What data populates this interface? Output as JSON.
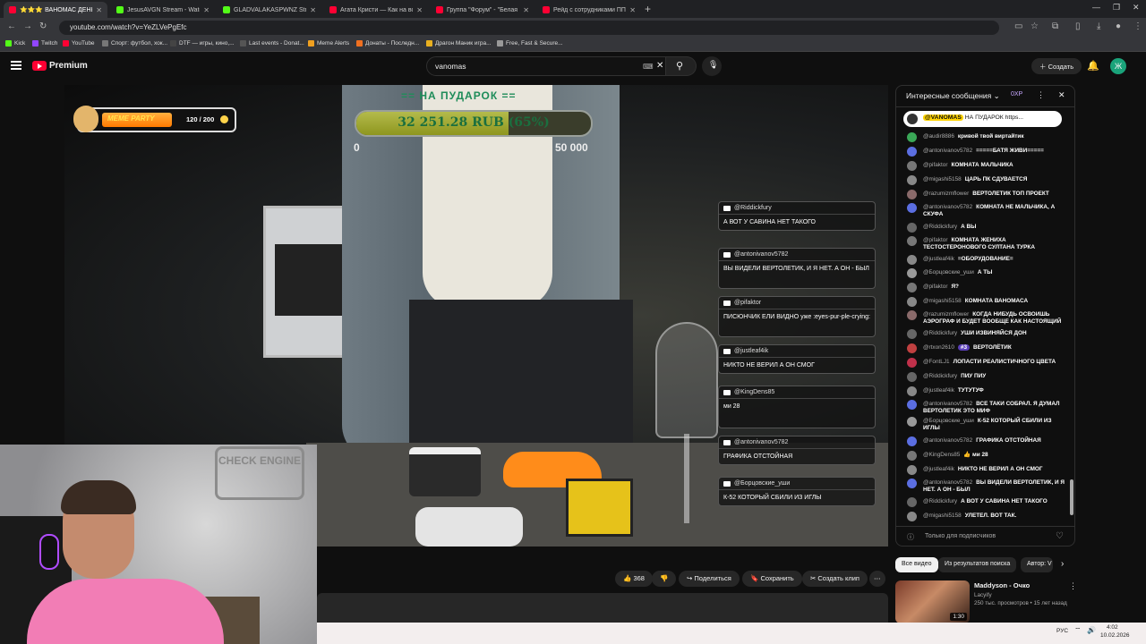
{
  "browser": {
    "tabs": [
      {
        "label": "⭐⭐⭐ ВАНОМАС ДЕНЬ РОЖ",
        "color": "#ff0033",
        "active": true
      },
      {
        "label": "JesusAVGN Stream - Watch Liv",
        "color": "#53fc18"
      },
      {
        "label": "GLADVALAKASPWNZ Stream -",
        "color": "#53fc18"
      },
      {
        "label": "Агата Кристи — Как на войне",
        "color": "#ff0033"
      },
      {
        "label": "Группа \"Форум\" - \"Белая ночь",
        "color": "#ff0033"
      },
      {
        "label": "Рейд с сотрудниками ППСП У",
        "color": "#ff0033"
      }
    ],
    "url": "youtube.com/watch?v=YeZLVePgEfc",
    "bookmarks": [
      "Kick",
      "Twitch",
      "YouTube",
      "Спорт: футбол, хок...",
      "DTF — игры, кино,...",
      "Last events - Donat...",
      "Meme Alerts",
      "Донаты - Последн...",
      "Драгон Маник игра...",
      "Free, Fast & Secure..."
    ]
  },
  "youtube": {
    "logo_text": "Premium",
    "search_value": "vanomas",
    "create_label": "Создать",
    "avatar_letter": "Ж"
  },
  "stream": {
    "meme_title": "MEME PARTY",
    "meme_count": "120 / 200",
    "goal_title": "== НА ПУДАРОК ==",
    "goal_amount": "32 251.28 RUB (65%)",
    "goal_progress": 0.65,
    "goal_min": "0",
    "goal_max": "50 000",
    "overlay_chat": [
      {
        "user": "@Riddickfury",
        "text": "А ВОТ У САВИНА НЕТ ТАКОГО"
      },
      {
        "user": "@antonivanov5782",
        "text": "ВЫ ВИДЕЛИ ВЕРТОЛЕТИК, И Я НЕТ. А ОН - БЫЛ"
      },
      {
        "user": "@pifaktor",
        "text": "ПИСЮНЧИК ЕЛИ ВИДНО уже :eyes-pur-ple-crying:"
      },
      {
        "user": "@justleaf4ik",
        "text": "НИКТО НЕ ВЕРИЛ А ОН СМОГ"
      },
      {
        "user": "@KingDens85",
        "text": "ми 28"
      },
      {
        "user": "@antonivanov5782",
        "text": "ГРАФИКА ОТСТОЙНАЯ"
      },
      {
        "user": "@Борцовские_уши",
        "text": "К-52 КОТОРЫЙ СБИЛИ ИЗ ИГЛЫ"
      }
    ],
    "cam_sign": "CHECK ENGINE"
  },
  "actions": {
    "likes": "368",
    "share": "Поделиться",
    "save": "Сохранить",
    "clip": "Создать клип",
    "more": "⋯"
  },
  "chat": {
    "header": "Интересные сообщения",
    "points": "0XP",
    "pinned_user": "@VANOMAS",
    "pinned_text": "НА ПУДАРОК https...",
    "messages": [
      {
        "user": "@audir8886",
        "text": "кривой твой виртайтик",
        "color": "#3aa757"
      },
      {
        "user": "@antonivanov5782",
        "text": "=====БАТЯ ЖИВИ=====",
        "color": "#5b6ee1"
      },
      {
        "user": "@pifaktor",
        "text": "КОМНАТА МАЛЬЧИКА",
        "color": "#777"
      },
      {
        "user": "@migashi5158",
        "text": "ЦАРЬ ПК СДУВАЕТСЯ",
        "color": "#888"
      },
      {
        "user": "@razumizmflower",
        "text": "ВЕРТОЛЕТИК ТОП ПРОЕКТ",
        "color": "#8a6a6a"
      },
      {
        "user": "@antonivanov5782",
        "text": "КОМНАТА НЕ МАЛЬЧИКА, А СКУФА",
        "color": "#5b6ee1"
      },
      {
        "user": "@Riddickfury",
        "text": "А ВЫ",
        "color": "#666"
      },
      {
        "user": "@pifaktor",
        "text": "КОМНАТА ЖЕНИХА ТЕСТОСТЕРОНОВОГО СУЛТАНА ТУРКА",
        "color": "#777"
      },
      {
        "user": "@justleaf4ik",
        "text": "=ОБОРУДОВАНИЕ=",
        "color": "#888"
      },
      {
        "user": "@Борцовские_уши",
        "text": "А ТЫ",
        "color": "#999"
      },
      {
        "user": "@pifaktor",
        "text": "Я?",
        "color": "#777"
      },
      {
        "user": "@migashi5158",
        "text": "КОМНАТА ВАНОМАСА",
        "color": "#888"
      },
      {
        "user": "@razumizmflower",
        "text": "КОГДА НИБУДЬ ОСВОИШЬ АЭРОГРАФ И БУДЕТ ВООБЩЕ КАК НАСТОЯЩИЙ",
        "color": "#8a6a6a"
      },
      {
        "user": "@Riddickfury",
        "text": "УШИ ИЗВИНЯЙСЯ ДОН",
        "color": "#666"
      },
      {
        "user": "@rtxon2610",
        "text": "ВЕРТОЛЁТИК",
        "color": "#c04040",
        "badge": "#3"
      },
      {
        "user": "@FontLJ1",
        "text": "ЛОПАСТИ РЕАЛИСТИЧНОГО ЦВЕТА",
        "color": "#c0304a"
      },
      {
        "user": "@Riddickfury",
        "text": "ПИУ ПИУ",
        "color": "#666"
      },
      {
        "user": "@justleaf4ik",
        "text": "ТУТУТУФ",
        "color": "#888"
      },
      {
        "user": "@antonivanov5782",
        "text": "ВСЕ ТАКИ СОБРАЛ. Я ДУМАЛ ВЕРТОЛЕТИК ЭТО МИФ",
        "color": "#5b6ee1"
      },
      {
        "user": "@Борцовские_уши",
        "text": "К-52 КОТОРЫЙ СБИЛИ ИЗ ИГЛЫ",
        "color": "#999"
      },
      {
        "user": "@antonivanov5782",
        "text": "ГРАФИКА ОТСТОЙНАЯ",
        "color": "#5b6ee1"
      },
      {
        "user": "@KingDens85",
        "text": "👍 ми 28",
        "color": "#777"
      },
      {
        "user": "@justleaf4ik",
        "text": "НИКТО НЕ ВЕРИЛ А ОН СМОГ",
        "color": "#888"
      },
      {
        "user": "@antonivanov5782",
        "text": "ВЫ ВИДЕЛИ ВЕРТОЛЕТИК, И Я НЕТ. А ОН - БЫЛ",
        "color": "#5b6ee1"
      },
      {
        "user": "@Riddickfury",
        "text": "А ВОТ У САВИНА НЕТ ТАКОГО",
        "color": "#666"
      },
      {
        "user": "@migashi5158",
        "text": "УЛЕТЕЛ. ВОТ ТАК.",
        "color": "#888"
      }
    ],
    "input_placeholder": "Только для подписчиков"
  },
  "recommend": {
    "chips": [
      "Все видео",
      "Из результатов поиска",
      "Автор: V"
    ],
    "video": {
      "title": "Maddyson - Очко",
      "channel": "Lacyify",
      "meta": "250 тыс. просмотров • 15 лет назад",
      "duration": "1:30"
    }
  },
  "taskbar": {
    "lang": "РУС",
    "time": "4:02",
    "date": "10.02.2026"
  }
}
